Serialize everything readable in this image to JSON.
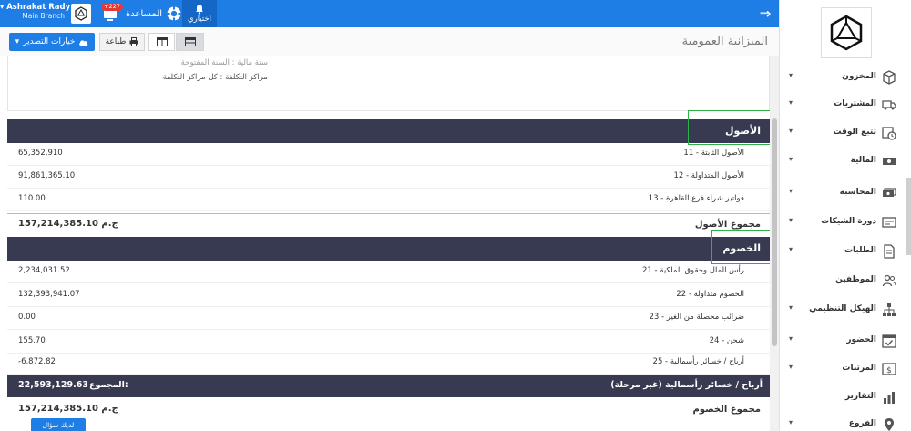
{
  "topbar": {
    "user_name": "▾ Ashrakat Rady",
    "user_branch": "Main Branch",
    "notif_count": "+227",
    "help_label": "المساعدة",
    "shortcuts_label": "اختياري"
  },
  "toolbar": {
    "title": "الميزانية العمومية",
    "export_label": "خيارات التصدير",
    "print_label": "طباعة"
  },
  "report": {
    "fiscal_year": "سنة مالية : السنة المفتوحة",
    "cost_centers": "مراكز التكلفة : كل مراكز التكلفة"
  },
  "assets": {
    "title": "الأصول",
    "rows": [
      {
        "account": "11 - الأصول الثابتة",
        "amount": "65,352,910"
      },
      {
        "account": "12 - الأصول المتداولة",
        "amount": "91,861,365.10"
      },
      {
        "account": "13 - فواتير شراء فرع القاهرة",
        "amount": "110.00"
      }
    ],
    "total_label": "مجموع الأصول",
    "total_value": "157,214,385.10 ج.م"
  },
  "liabilities": {
    "title": "الخصوم",
    "rows": [
      {
        "account": "21 - رأس المال وحقوق الملكية",
        "amount": "2,234,031.52"
      },
      {
        "account": "22 - الخصوم متداولة",
        "amount": "132,393,941.07"
      },
      {
        "account": "23 - ضرائب محصلة من الغير",
        "amount": "0.00"
      },
      {
        "account": "24 - شحن",
        "amount": "155.70"
      },
      {
        "account": "25 - أرباح / خسائر رأسمالية",
        "amount": "-6,872.82"
      }
    ],
    "pl_label": "أرباح / خسائر رأسمالية (غير مرحلة)",
    "pl_sub_label": "المجموع:",
    "pl_value": "22,593,129.63",
    "total_label": "مجموع الخصوم",
    "total_value": "157,214,385.10 ج.م"
  },
  "ask_button": "لديك سؤال",
  "sidebar": {
    "items": [
      {
        "label": "المخزون",
        "icon": "box-icon"
      },
      {
        "label": "المشتريات",
        "icon": "truck-icon"
      },
      {
        "label": "تتبع الوقت",
        "icon": "clock-calendar-icon"
      },
      {
        "label": "المالية",
        "icon": "money-icon"
      },
      {
        "label": "المحاسبة",
        "icon": "money-bills-icon"
      },
      {
        "label": "دورة الشيكات",
        "icon": "check-card-icon"
      },
      {
        "label": "الطلبات",
        "icon": "document-icon"
      },
      {
        "label": "الموظفين",
        "icon": "users-icon"
      },
      {
        "label": "الهيكل التنظيمي",
        "icon": "org-chart-icon"
      },
      {
        "label": "الحضور",
        "icon": "calendar-check-icon"
      },
      {
        "label": "المرتبات",
        "icon": "payroll-icon"
      },
      {
        "label": "التقارير",
        "icon": "bar-chart-icon"
      },
      {
        "label": "الفروع",
        "icon": "location-pin-icon"
      }
    ]
  },
  "colors": {
    "primary": "#1f7ee6",
    "section_header": "#383a52",
    "highlight": "#2bb34a",
    "badge": "#e53935"
  }
}
